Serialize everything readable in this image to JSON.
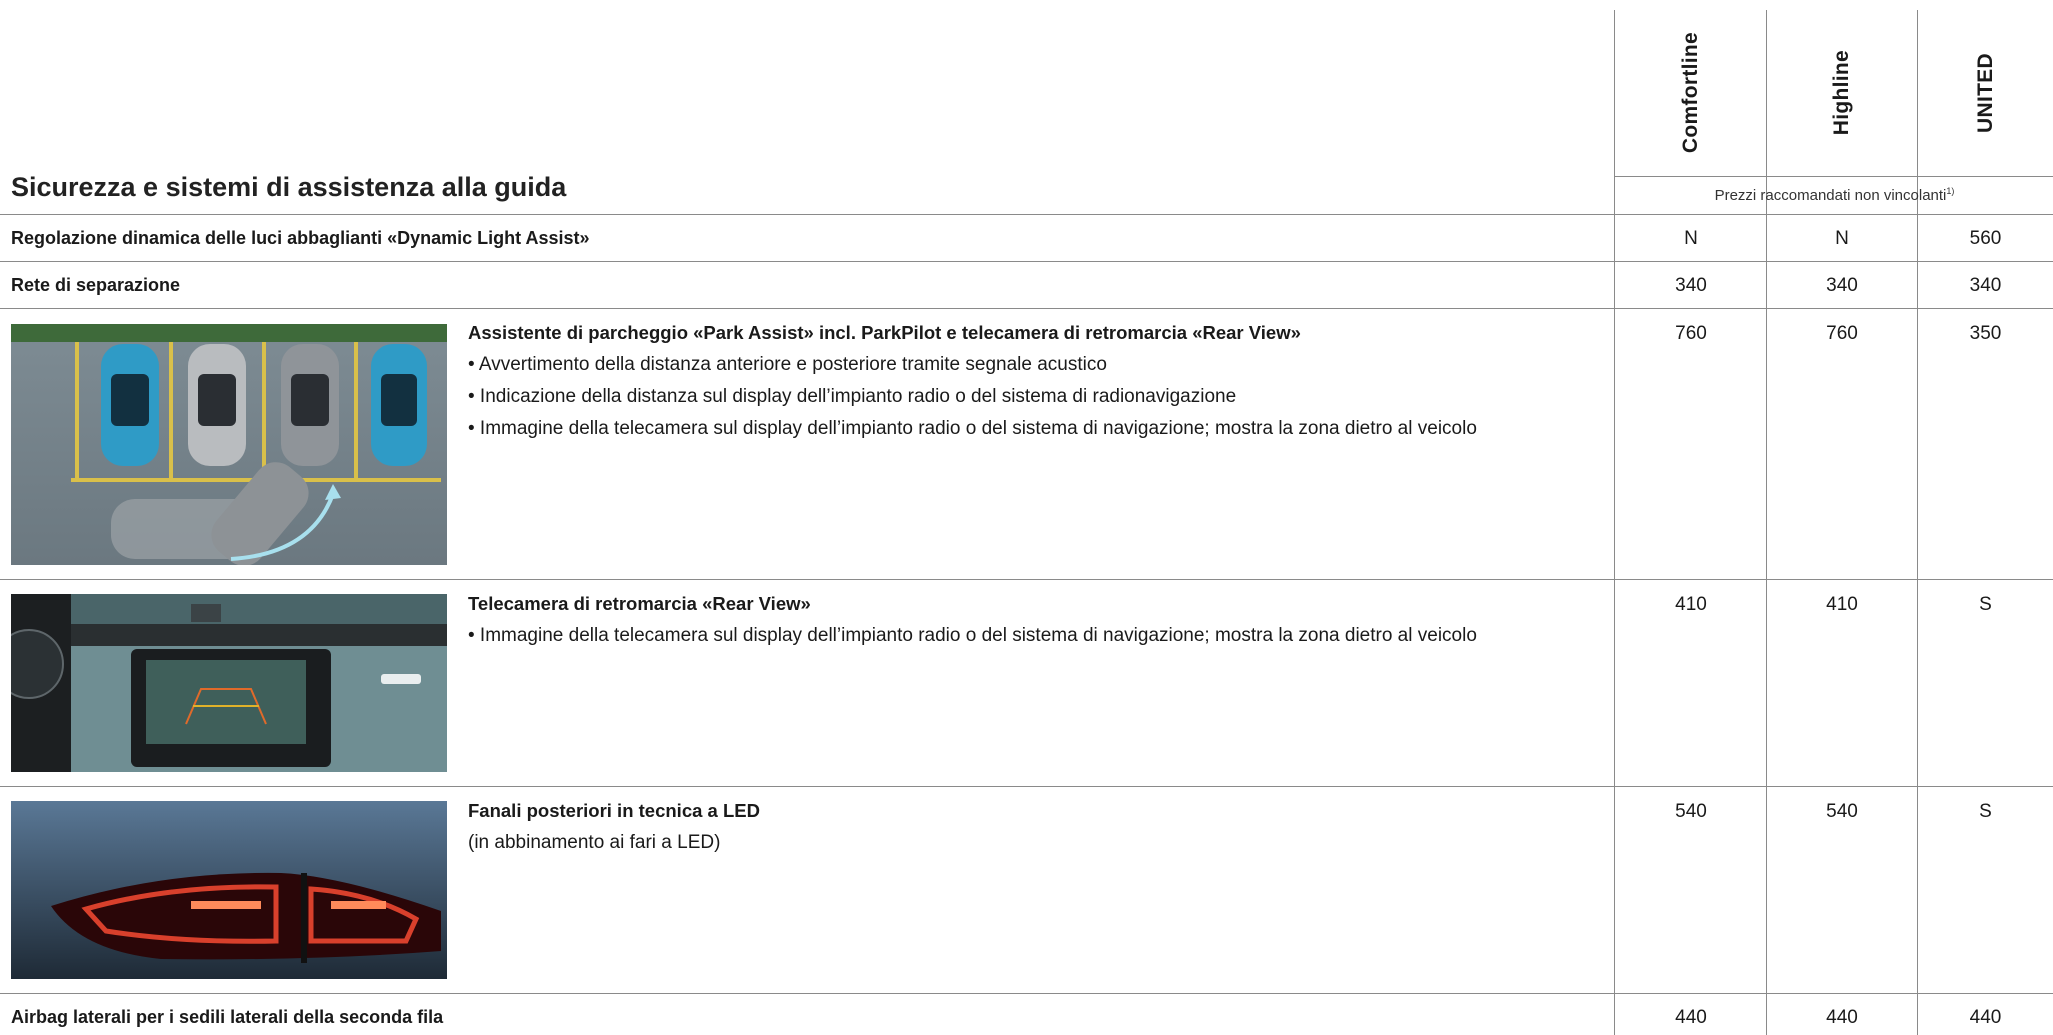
{
  "section_title": "Sicurezza e sistemi di assistenza alla guida",
  "columns": [
    "Comfortline",
    "Highline",
    "UNITED"
  ],
  "prices_note": "Prezzi raccomandati non vincolanti",
  "prices_note_sup": "1)",
  "rows": [
    {
      "label": "Regolazione dinamica delle luci abbaglianti «Dynamic Light Assist»",
      "values": [
        "N",
        "N",
        "560"
      ]
    },
    {
      "label": "Rete di separazione",
      "values": [
        "340",
        "340",
        "340"
      ]
    },
    {
      "image": "parking-assist-illustration",
      "heading": "Assistente di parcheggio «Park Assist» incl. ParkPilot e telecamera di retromarcia «Rear View»",
      "lines": [
        "• Avvertimento della distanza anteriore e posteriore tramite segnale acustico",
        "• Indicazione della distanza sul display dell’impianto radio o del sistema di radionavigazione",
        "• Immagine della telecamera sul display dell’impianto radio o del sistema di navigazione; mostra la zona dietro al veicolo"
      ],
      "values": [
        "760",
        "760",
        "350"
      ]
    },
    {
      "image": "rear-view-camera-photo",
      "heading": "Telecamera di retromarcia «Rear View»",
      "lines": [
        "• Immagine della telecamera sul display dell’impianto radio o del sistema di navigazione; mostra la zona dietro al veicolo"
      ],
      "values": [
        "410",
        "410",
        "S"
      ]
    },
    {
      "image": "led-taillight-photo",
      "heading": "Fanali posteriori in tecnica a LED",
      "lines": [
        "(in abbinamento ai fari a LED)"
      ],
      "values": [
        "540",
        "540",
        "S"
      ]
    },
    {
      "label": "Airbag laterali per i sedili laterali della seconda fila",
      "values": [
        "440",
        "440",
        "440"
      ]
    }
  ],
  "colors": {
    "rule": "#8a8a8a",
    "text": "#1a1a1a"
  }
}
